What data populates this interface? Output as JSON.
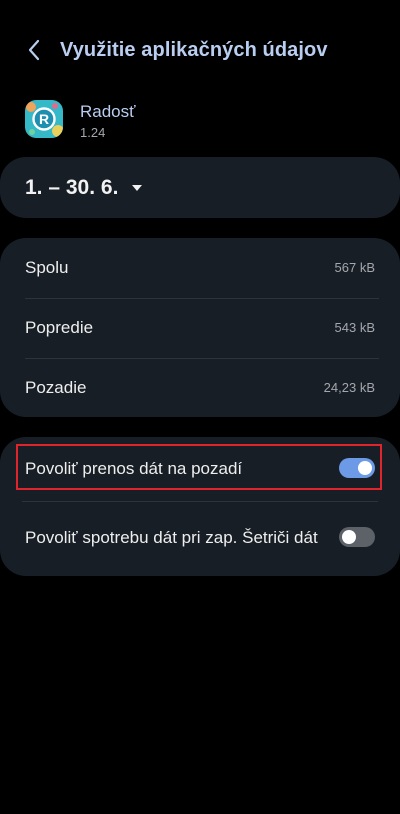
{
  "header": {
    "title": "Využitie aplikačných údajov",
    "back_icon": "chevron-left-icon"
  },
  "app": {
    "name": "Radosť",
    "version": "1.24",
    "icon": "app-logo-icon",
    "icon_color": "#35b8c7"
  },
  "date_range": {
    "label": "1. – 30. 6.",
    "dropdown_icon": "caret-down-icon"
  },
  "usage": [
    {
      "label": "Spolu",
      "value": "567 kB"
    },
    {
      "label": "Popredie",
      "value": "543 kB"
    },
    {
      "label": "Pozadie",
      "value": "24,23 kB"
    }
  ],
  "toggles": [
    {
      "label": "Povoliť prenos dát na pozadí",
      "state": "on"
    },
    {
      "label": "Povoliť spotrebu dát pri zap. Šetriči dát",
      "state": "off"
    }
  ],
  "colors": {
    "background": "#000000",
    "card": "#171e26",
    "accent": "#6d9ae6",
    "title": "#b9cef0",
    "highlight": "#e0242c"
  }
}
